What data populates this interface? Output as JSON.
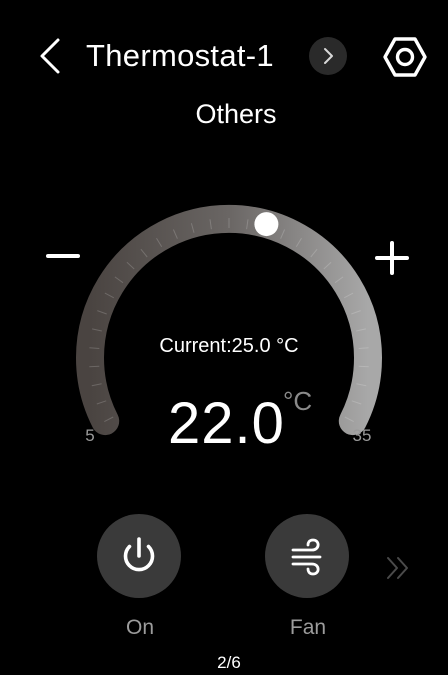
{
  "header": {
    "title": "Thermostat-1",
    "mode": "Others"
  },
  "thermostat": {
    "current_reading": "Current:25.0 °C",
    "setpoint": "22.0",
    "setpoint_unit": "°C",
    "range_min": "5",
    "range_max": "35",
    "setpoint_value": 22,
    "min_value": 5,
    "max_value": 35
  },
  "controls": {
    "power_label": "On",
    "fan_label": "Fan"
  },
  "pagination": {
    "indicator": "2/6"
  },
  "colors": {
    "background": "#000000",
    "button": "#3a3a3a",
    "arc_start": "#4a4441",
    "arc_end": "#a8a8a8",
    "knob": "#ffffff"
  },
  "icons": [
    "back-arrow-icon",
    "chevron-right-icon",
    "gear-icon",
    "minus-icon",
    "plus-icon",
    "power-icon",
    "fan-icon",
    "double-chevron-right-icon"
  ]
}
